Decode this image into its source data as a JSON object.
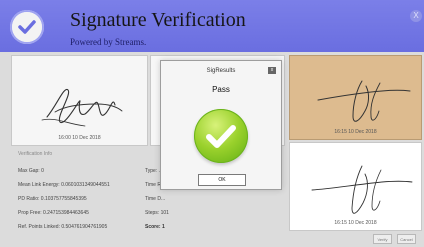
{
  "header": {
    "title": "Signature Verification",
    "subtitle": "Powered by Streams.",
    "close_glyph": "X"
  },
  "panels": {
    "left": {
      "date": "16:00  10 Dec 2018"
    },
    "right_top": {
      "date": "16:15  10 Dec 2018"
    },
    "right_bottom": {
      "date": "16:15  10 Dec 2018"
    }
  },
  "info_title": "Verification Info",
  "info": {
    "rows": [
      "Max Gap: 0",
      "Mean Link Energy: 0.0601031349044551",
      "PD Ratio: 0.103757755845395",
      "Prop Free: 0.247153984463645",
      "Ref. Points Linked: 0.504761904761905"
    ]
  },
  "mid": {
    "rows": [
      "Type: ...",
      "Time R...",
      "Time D...",
      "Steps: 101",
      "Score: 1"
    ]
  },
  "dialog": {
    "title": "SigResults",
    "status": "Pass",
    "ok_label": "OK",
    "close_glyph": "x"
  },
  "buttons": {
    "verify_label": "Verify",
    "cancel_label": "Cancel"
  },
  "colors": {
    "header_purple": "#6f73e2",
    "pass_green": "#8ccc28"
  }
}
